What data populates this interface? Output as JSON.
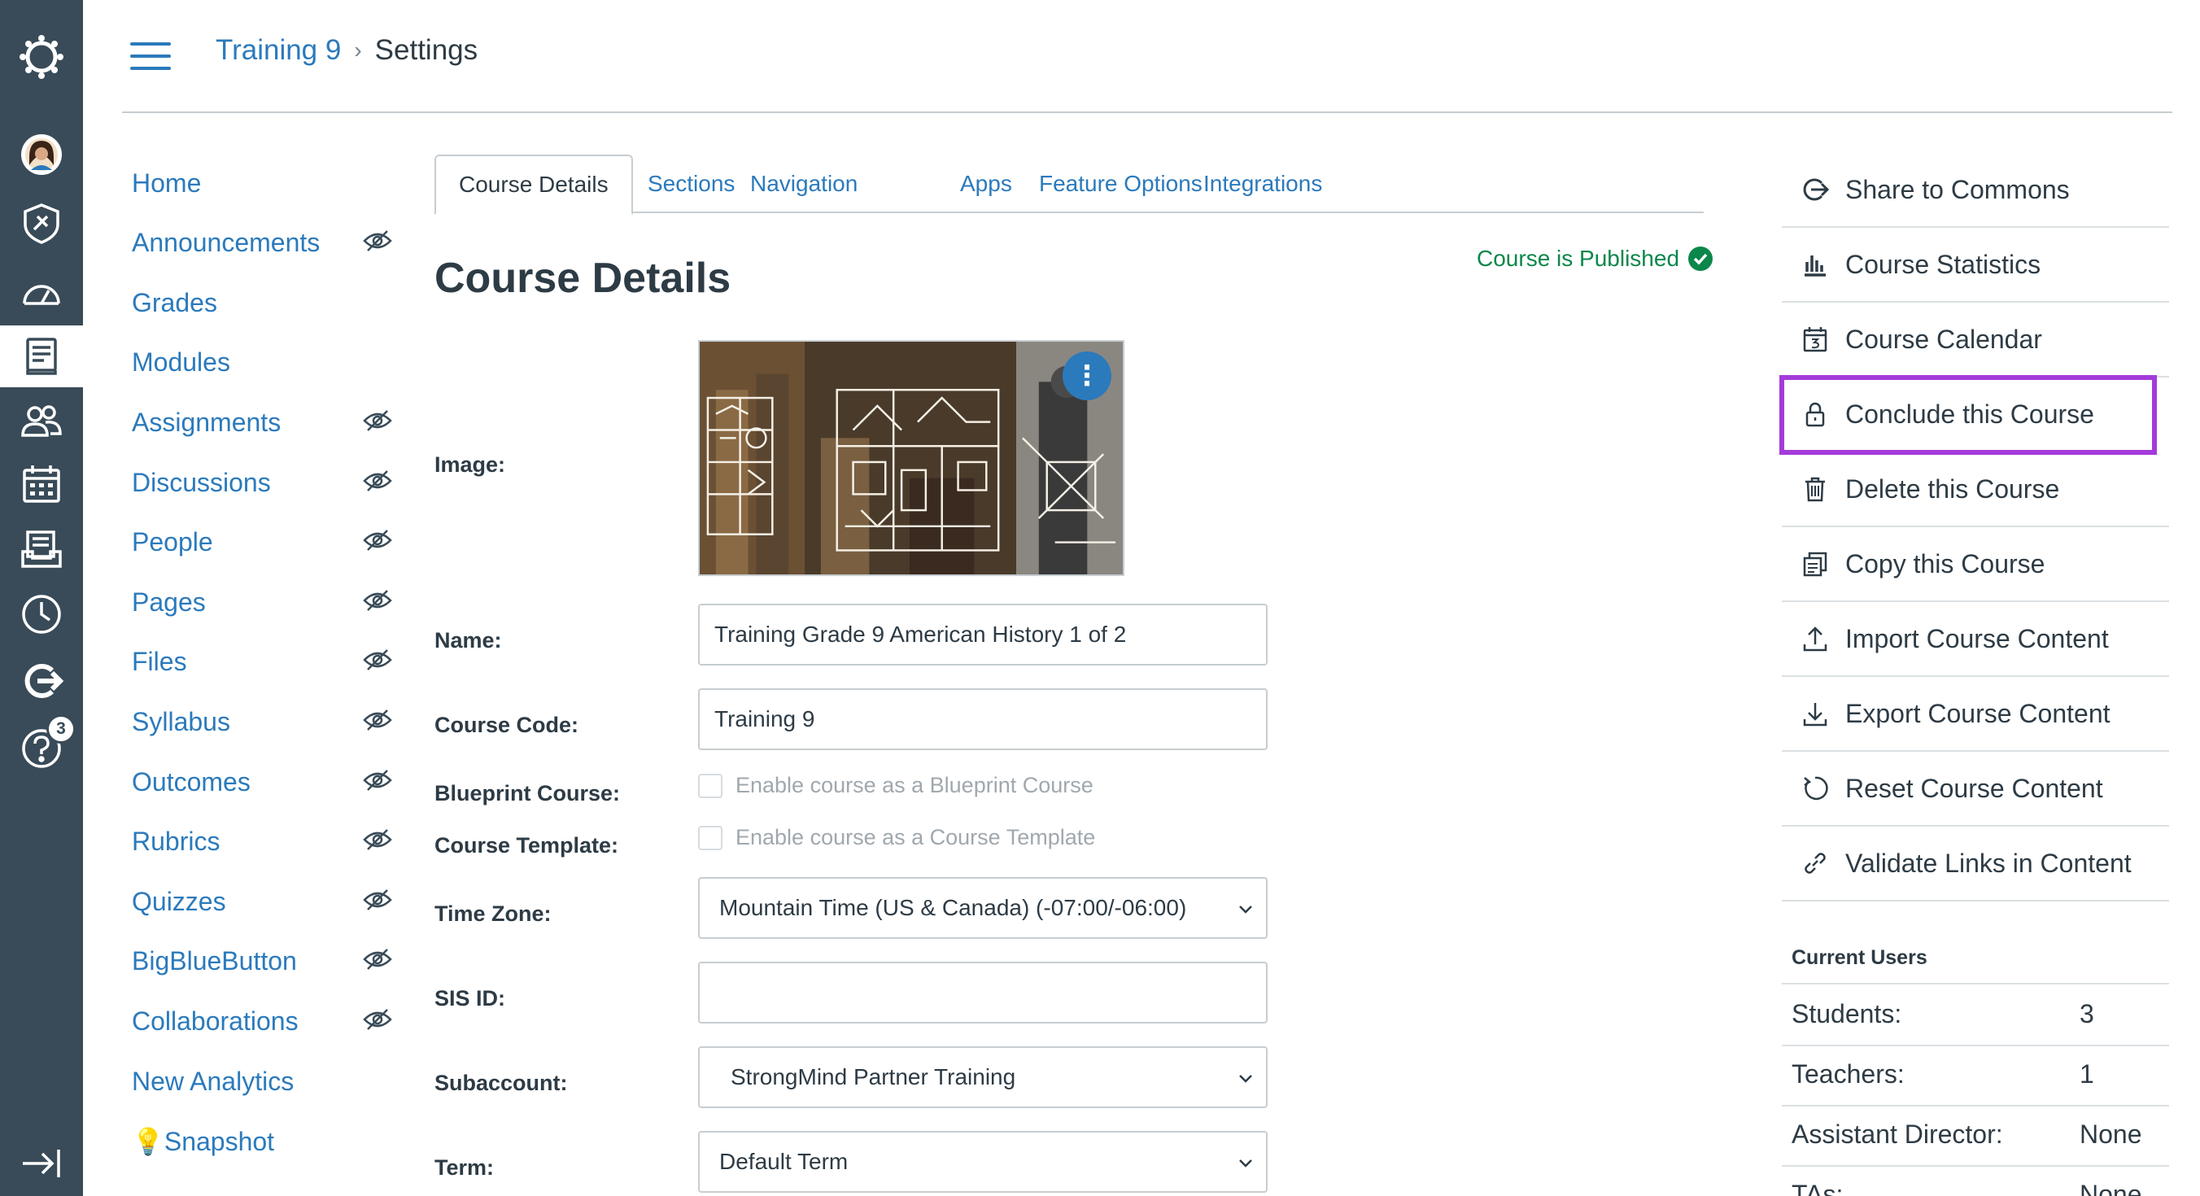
{
  "header": {
    "breadcrumb_course": "Training 9",
    "breadcrumb_sep": "›",
    "breadcrumb_current": "Settings"
  },
  "global_nav": {
    "items": [
      "logo-icon",
      "account-avatar-icon",
      "admin-icon",
      "dashboard-icon",
      "courses-icon",
      "groups-icon",
      "calendar-icon",
      "inbox-icon",
      "history-icon",
      "commons-icon",
      "help-icon",
      "collapse-nav-icon"
    ],
    "help_badge": "3",
    "active": "courses-icon"
  },
  "course_nav": {
    "items": [
      {
        "label": "Home",
        "hidden": false
      },
      {
        "label": "Announcements",
        "hidden": true
      },
      {
        "label": "Grades",
        "hidden": false
      },
      {
        "label": "Modules",
        "hidden": false
      },
      {
        "label": "Assignments",
        "hidden": true
      },
      {
        "label": "Discussions",
        "hidden": true
      },
      {
        "label": "People",
        "hidden": true
      },
      {
        "label": "Pages",
        "hidden": true
      },
      {
        "label": "Files",
        "hidden": true
      },
      {
        "label": "Syllabus",
        "hidden": true
      },
      {
        "label": "Outcomes",
        "hidden": true
      },
      {
        "label": "Rubrics",
        "hidden": true
      },
      {
        "label": "Quizzes",
        "hidden": true
      },
      {
        "label": "BigBlueButton",
        "hidden": true
      },
      {
        "label": "Collaborations",
        "hidden": true
      },
      {
        "label": "New Analytics",
        "hidden": false
      },
      {
        "label": "💡Snapshot",
        "hidden": false
      }
    ]
  },
  "tabs": [
    "Course Details",
    "Sections",
    "Navigation",
    "Apps",
    "Feature Options",
    "Integrations"
  ],
  "active_tab": "Course Details",
  "main": {
    "title": "Course Details",
    "published": "Course is Published",
    "image_label": "Image:",
    "name_label": "Name:",
    "name_value": "Training Grade 9 American History 1 of 2",
    "code_label": "Course Code:",
    "code_value": "Training 9",
    "blueprint_label": "Blueprint Course:",
    "blueprint_text": "Enable course as a Blueprint Course",
    "template_label": "Course Template:",
    "template_text": "Enable course as a Course Template",
    "timezone_label": "Time Zone:",
    "timezone_value": "Mountain Time (US & Canada) (-07:00/-06:00)",
    "sis_label": "SIS ID:",
    "sis_value": "",
    "subaccount_label": "Subaccount:",
    "subaccount_value": "StrongMind Partner Training",
    "term_label": "Term:",
    "term_value": "Default Term"
  },
  "sidebar": {
    "actions": [
      {
        "label": "Share to Commons",
        "icon": "commons-icon"
      },
      {
        "label": "Course Statistics",
        "icon": "stats-icon"
      },
      {
        "label": "Course Calendar",
        "icon": "calendar-icon"
      },
      {
        "label": "Conclude this Course",
        "icon": "lock-icon",
        "highlighted": true
      },
      {
        "label": "Delete this Course",
        "icon": "trash-icon"
      },
      {
        "label": "Copy this Course",
        "icon": "copy-icon"
      },
      {
        "label": "Import Course Content",
        "icon": "upload-icon"
      },
      {
        "label": "Export Course Content",
        "icon": "download-icon"
      },
      {
        "label": "Reset Course Content",
        "icon": "reset-icon"
      },
      {
        "label": "Validate Links in Content",
        "icon": "link-icon"
      }
    ],
    "current_users_heading": "Current Users",
    "users": [
      {
        "role": "Students:",
        "count": "3"
      },
      {
        "role": "Teachers:",
        "count": "1"
      },
      {
        "role": "Assistant Director:",
        "count": "None"
      },
      {
        "role": "TAs:",
        "count": "None"
      }
    ]
  },
  "colors": {
    "nav_bg": "#394b58",
    "link": "#2b7abc",
    "published": "#0b874b",
    "highlight": "#a43bdb"
  }
}
